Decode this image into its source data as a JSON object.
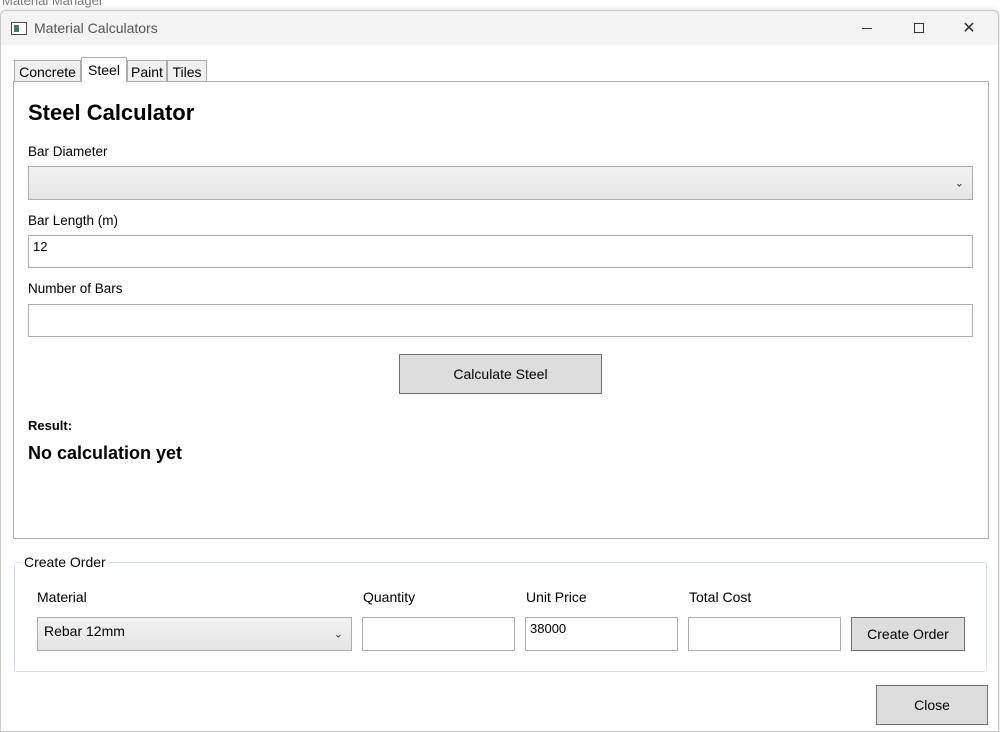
{
  "parent_window": {
    "title": "Material Manager"
  },
  "window": {
    "title": "Material Calculators"
  },
  "tabs": [
    {
      "label": "Concrete"
    },
    {
      "label": "Steel"
    },
    {
      "label": "Paint"
    },
    {
      "label": "Tiles"
    }
  ],
  "active_tab": "Steel",
  "steel": {
    "heading": "Steel Calculator",
    "bar_diameter_label": "Bar Diameter",
    "bar_diameter_value": "",
    "bar_length_label": "Bar Length (m)",
    "bar_length_value": "12",
    "number_of_bars_label": "Number of Bars",
    "number_of_bars_value": "",
    "calculate_button": "Calculate Steel",
    "result_label": "Result:",
    "result_value": "No calculation yet"
  },
  "order": {
    "group_title": "Create Order",
    "material_label": "Material",
    "material_value": "Rebar 12mm",
    "quantity_label": "Quantity",
    "quantity_value": "",
    "unit_price_label": "Unit Price",
    "unit_price_value": "38000",
    "total_cost_label": "Total Cost",
    "total_cost_value": "",
    "create_button": "Create Order"
  },
  "footer": {
    "close_button": "Close"
  },
  "icons": {
    "app": "app-window-icon",
    "minimize": "minimize-icon",
    "maximize": "maximize-icon",
    "close": "close-icon",
    "dropdown": "chevron-down-icon"
  }
}
